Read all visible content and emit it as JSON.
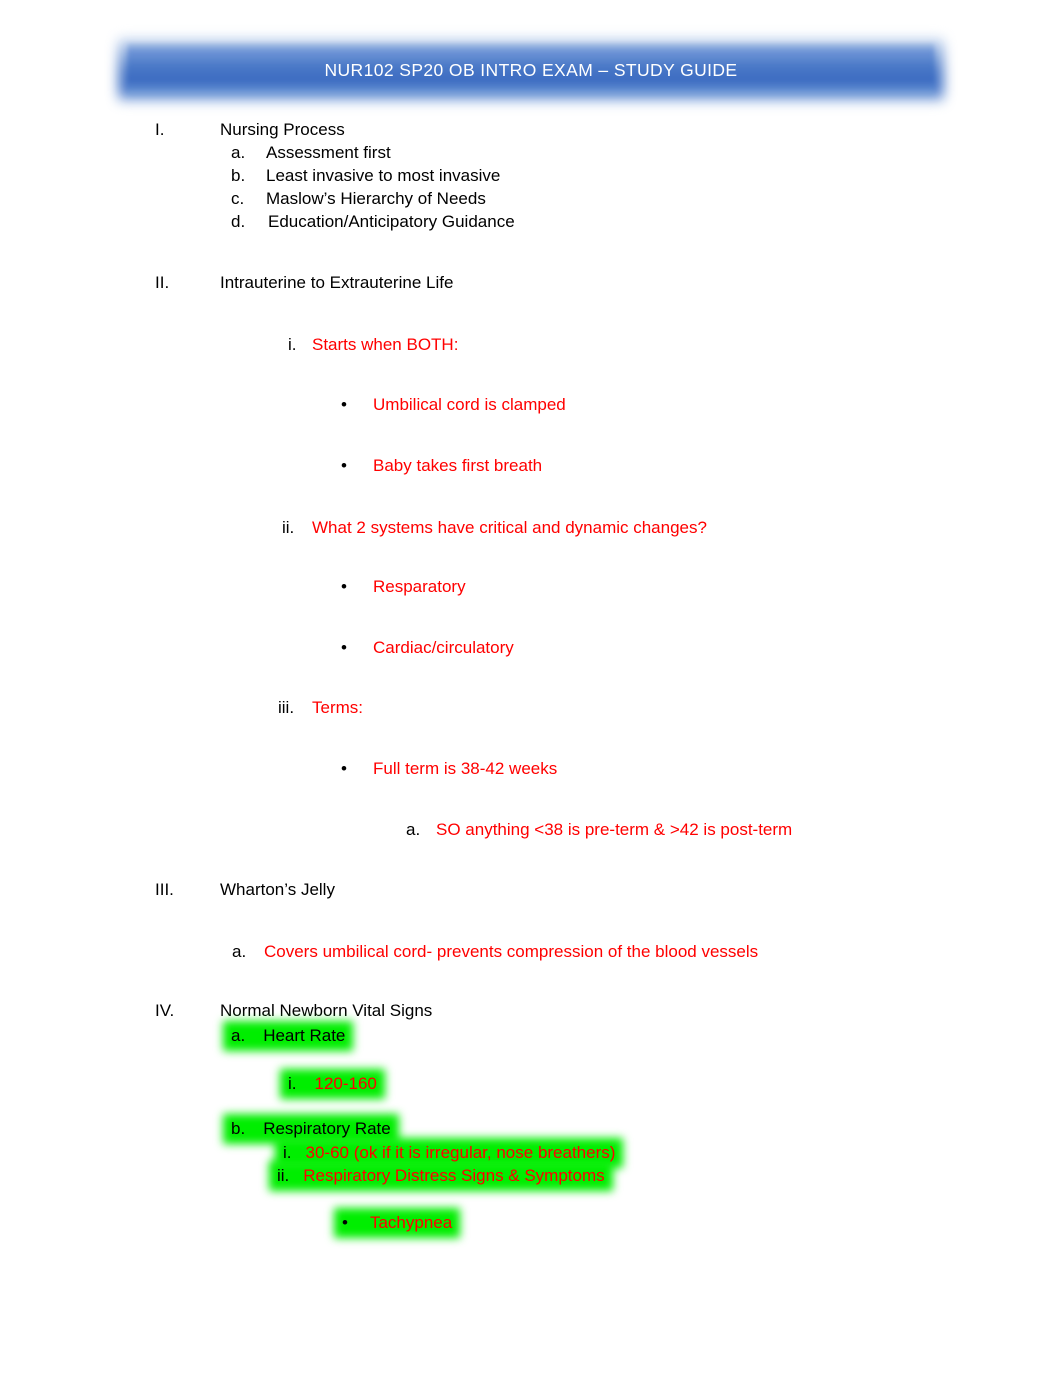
{
  "document": {
    "title": "NUR102 SP20 OB INTRO EXAM – STUDY GUIDE"
  },
  "sections": [
    {
      "marker": "I.",
      "heading": "Nursing Process",
      "items": [
        {
          "marker": "a.",
          "text": "Assessment first"
        },
        {
          "marker": "b.",
          "text": "Least invasive to most invasive"
        },
        {
          "marker": "c.",
          "text": "Maslow’s Hierarchy of Needs"
        },
        {
          "marker": "d.",
          "text": "Education/Anticipatory Guidance"
        }
      ]
    },
    {
      "marker": "II.",
      "heading": "Intrauterine to Extrauterine Life",
      "items": [
        {
          "marker": "i.",
          "text": "Starts when BOTH:"
        },
        {
          "marker": "•",
          "text": "Umbilical cord is clamped"
        },
        {
          "marker": "•",
          "text": "Baby takes first breath"
        },
        {
          "marker": "ii.",
          "text": "What 2 systems have critical and dynamic changes?"
        },
        {
          "marker": "•",
          "text": "Resparatory"
        },
        {
          "marker": "•",
          "text": "Cardiac/circulatory"
        },
        {
          "marker": "iii.",
          "text": "Terms:"
        },
        {
          "marker": "•",
          "text": "Full term is 38-42 weeks"
        },
        {
          "marker": "a.",
          "text": "SO anything <38 is pre-term & >42 is post-term"
        }
      ]
    },
    {
      "marker": "III.",
      "heading": "Wharton’s Jelly",
      "items": [
        {
          "marker": "a.",
          "text": "Covers umbilical cord- prevents compression of the blood vessels"
        }
      ]
    },
    {
      "marker": "IV.",
      "heading": "Normal Newborn Vital Signs",
      "items": [
        {
          "marker": "a.",
          "text": "Heart Rate"
        },
        {
          "marker": "i.",
          "text": "120-160"
        },
        {
          "marker": "b.",
          "text": "Respiratory Rate"
        },
        {
          "marker": "i.",
          "text": "30-60 (ok if it is irregular, nose breathers)"
        },
        {
          "marker": "ii.",
          "text": "Respiratory Distress Signs & Symptoms"
        },
        {
          "marker": "•",
          "text": "Tachypnea"
        }
      ]
    }
  ],
  "colors": {
    "red_text": "#ff0000",
    "black_text": "#000000",
    "green_highlight": "#00ee00",
    "banner_blue": "#4a79c7",
    "banner_title_text": "#ffffff"
  }
}
